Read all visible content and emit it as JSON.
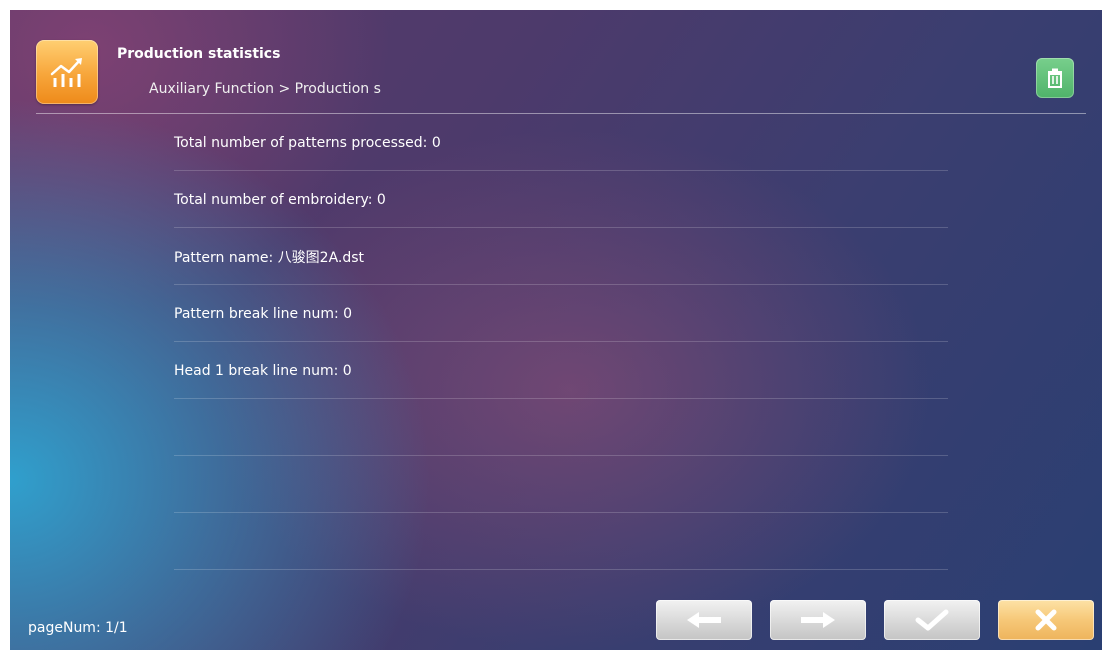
{
  "header": {
    "title": "Production statistics",
    "breadcrumb": "Auxiliary Function > Production s"
  },
  "icons": {
    "app": "statistics-chart-icon",
    "delete": "trash-icon",
    "prev": "arrow-left-icon",
    "next": "arrow-right-icon",
    "confirm": "checkmark-icon",
    "close": "close-icon"
  },
  "stats": [
    "Total number of patterns processed: 0",
    "Total number of embroidery: 0",
    "Pattern name: 八骏图2A.dst",
    "Pattern break line num: 0",
    "Head 1 break line num: 0",
    "",
    "",
    ""
  ],
  "footer": {
    "page_num": "pageNum: 1/1"
  },
  "colors": {
    "accent_orange": "#f7a53a",
    "delete_green": "#4fb36a",
    "gray_button": "#d6d6d6",
    "close_button": "#f6c878"
  }
}
